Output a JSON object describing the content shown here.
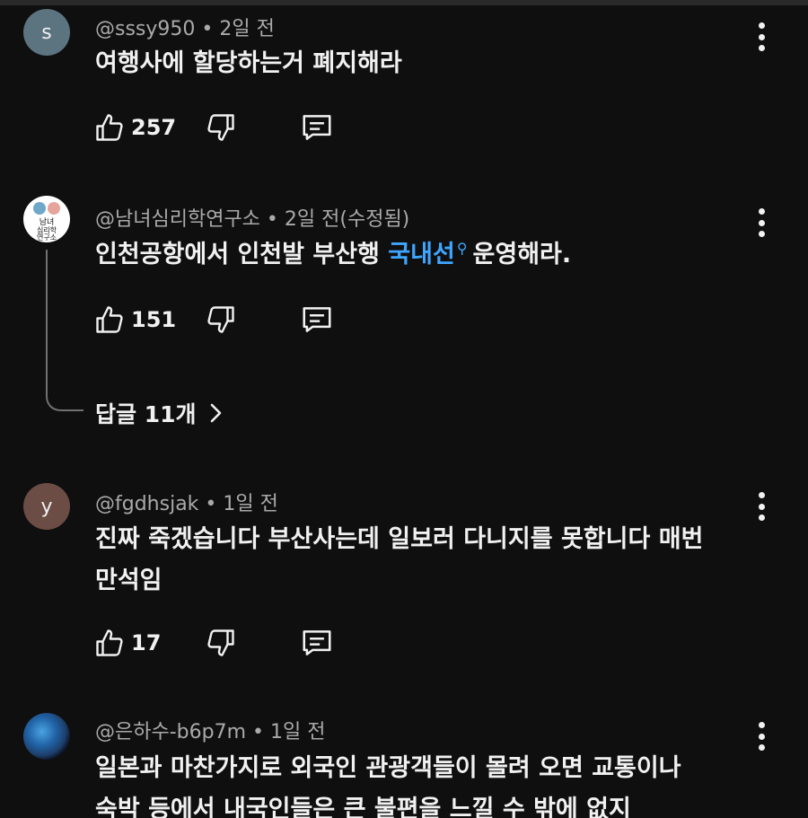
{
  "comments": [
    {
      "handle": "@sssy950",
      "time": "2일 전",
      "avatar_text": "s",
      "text": "여행사에 할당하는거 폐지해라",
      "likes": "257"
    },
    {
      "handle": "@남녀심리학연구소",
      "time": "2일 전(수정됨)",
      "avatar_text": "남녀 심리학 연구소",
      "text_before": "인천공항에서 인천발 부산행 ",
      "link": "국내선",
      "text_after": "운영해라.",
      "likes": "151",
      "replies_label": "답글 11개"
    },
    {
      "handle": "@fgdhsjak",
      "time": "1일 전",
      "avatar_text": "y",
      "text_line1": "진짜 죽겠습니다 부산사는데 일보러 다니지를 못합니다 매번",
      "text_line2": "만석임",
      "likes": "17"
    },
    {
      "handle": "@은하수-b6p7m",
      "time": "1일 전",
      "text_line1": "일본과 마찬가지로 외국인 관광객들이 몰려 오면 교통이나",
      "text_line2": "숙박 등에서 내국인들은 큰 불편을 느낄 수 밖에 없지"
    }
  ],
  "icons": {
    "like": "thumbs-up-icon",
    "dislike": "thumbs-down-icon",
    "reply": "comment-icon",
    "more": "more-vertical-icon",
    "search": "search-icon",
    "chevron": "chevron-right-icon"
  },
  "colors": {
    "background": "#0f0f0f",
    "text": "#f1f1f1",
    "secondary": "#aaaaaa",
    "link": "#3ea6ff"
  }
}
